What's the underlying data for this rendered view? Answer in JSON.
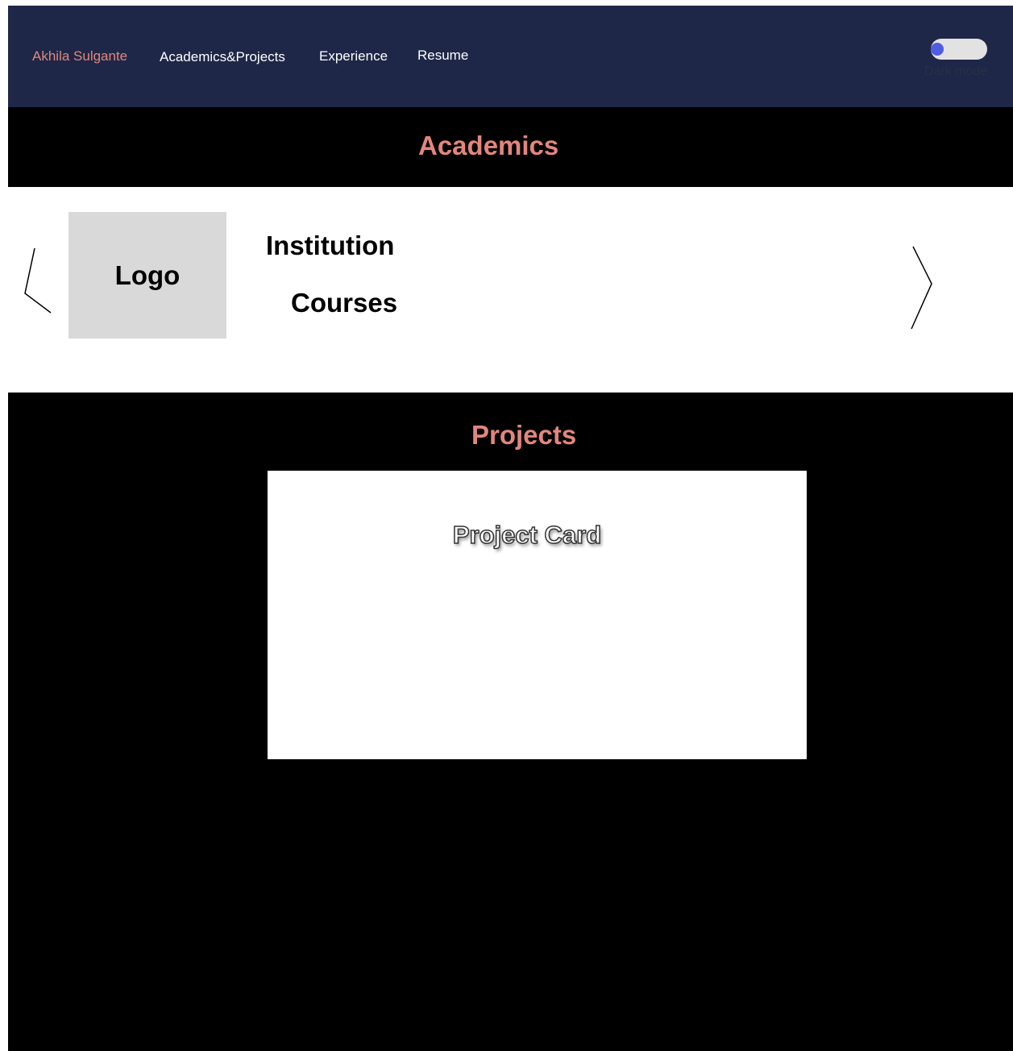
{
  "nav": {
    "brand": "Akhila Sulgante",
    "links": [
      "Academics&Projects",
      "Experience",
      "Resume"
    ],
    "toggle_label": "Dark mode",
    "toggle_on": false
  },
  "academics": {
    "title": "Academics",
    "logo_label": "Logo",
    "institution_label": "Institution",
    "courses_label": "Courses",
    "prev_icon": "chevron-left-icon",
    "next_icon": "chevron-right-icon"
  },
  "projects": {
    "title": "Projects",
    "card_title": "Project Card"
  },
  "colors": {
    "nav_bg": "#1e2747",
    "accent": "#e2867d",
    "page_bg": "#000000",
    "toggle_knob": "#4f5ce0"
  }
}
